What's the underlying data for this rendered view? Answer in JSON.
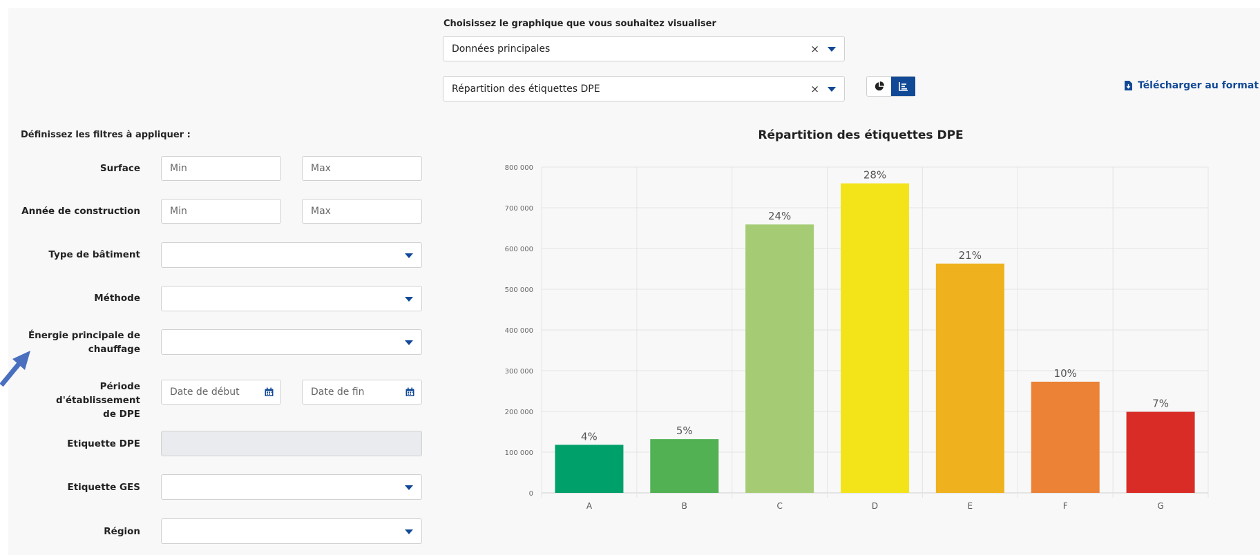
{
  "chart_selector": {
    "label": "Choisissez le graphique que vous souhaitez visualiser",
    "dataset_value": "Données principales",
    "chart_value": "Répartition des étiquettes DPE",
    "clear_symbol": "×"
  },
  "view_toggle": {
    "icons": [
      "pie-chart-icon",
      "bar-chart-icon"
    ],
    "active": "bar-chart-icon",
    "active_color": "#124996"
  },
  "download": {
    "label": "Télécharger au format CSV",
    "icon": "file-download-icon"
  },
  "filters": {
    "title": "Définissez les filtres à appliquer :",
    "surface": {
      "label": "Surface",
      "min_placeholder": "Min",
      "max_placeholder": "Max"
    },
    "annee": {
      "label": "Année de construction",
      "min_placeholder": "Min",
      "max_placeholder": "Max"
    },
    "type_batiment": {
      "label": "Type de bâtiment"
    },
    "methode": {
      "label": "Méthode"
    },
    "energie": {
      "label_line1": "Énergie principale de",
      "label_line2": "chauffage"
    },
    "periode": {
      "label_line1": "Période d'établissement",
      "label_line2": "de DPE",
      "start_placeholder": "Date de début",
      "end_placeholder": "Date de fin"
    },
    "etiquette_dpe": {
      "label": "Etiquette DPE"
    },
    "etiquette_ges": {
      "label": "Etiquette GES"
    },
    "region": {
      "label": "Région"
    }
  },
  "chart_data": {
    "type": "bar",
    "title": "Répartition des étiquettes DPE",
    "categories": [
      "A",
      "B",
      "C",
      "D",
      "E",
      "F",
      "G"
    ],
    "values": [
      118000,
      132000,
      659000,
      760000,
      563000,
      273000,
      199000
    ],
    "labels": [
      "4%",
      "5%",
      "24%",
      "28%",
      "21%",
      "10%",
      "7%"
    ],
    "colors": [
      "#00a06a",
      "#51b153",
      "#a5cc74",
      "#f3e41a",
      "#efb11d",
      "#eb8235",
      "#d92c26"
    ],
    "ylim": [
      0,
      800000
    ],
    "yticks": [
      0,
      100000,
      200000,
      300000,
      400000,
      500000,
      600000,
      700000,
      800000
    ],
    "ytick_labels": [
      "0",
      "100 000",
      "200 000",
      "300 000",
      "400 000",
      "500 000",
      "600 000",
      "700 000",
      "800 000"
    ],
    "grid": true,
    "xlabel": "",
    "ylabel": ""
  }
}
